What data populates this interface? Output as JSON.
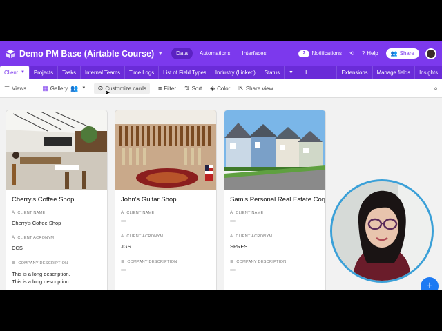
{
  "colors": {
    "brand": "#7c39ed",
    "tab_bar": "#6a2bd8",
    "fab": "#1d7af3",
    "webcam_ring": "#3aa0d8"
  },
  "header": {
    "base_title": "Demo PM Base (Airtable Course)",
    "nav": [
      "Data",
      "Automations",
      "Interfaces"
    ],
    "active_nav": "Data",
    "notifications_badge": "2",
    "notifications_label": "Notifications",
    "help_label": "Help",
    "share_label": "Share"
  },
  "tabs": {
    "items": [
      "Client",
      "Projects",
      "Tasks",
      "Internal Teams",
      "Time Logs",
      "List of Field Types",
      "Industry (Linked)",
      "Status"
    ],
    "active": "Client",
    "right": [
      "Extensions",
      "Manage fields",
      "Insights"
    ]
  },
  "toolbar": {
    "views_label": "Views",
    "view_name": "Gallery",
    "customize_label": "Customize cards",
    "filter_label": "Filter",
    "sort_label": "Sort",
    "color_label": "Color",
    "share_view_label": "Share view"
  },
  "field_labels": {
    "client_name": "CLIENT NAME",
    "client_acronym": "CLIENT ACRONYM",
    "company_description": "COMPANY DESCRIPTION"
  },
  "cards": [
    {
      "title": "Cherry's Coffee Shop",
      "client_name": "Cherry's Coffee Shop",
      "client_acronym": "CCS",
      "description": [
        "This is a long description.",
        "This is a long description."
      ]
    },
    {
      "title": "John's Guitar Shop",
      "client_name": "",
      "client_acronym": "JGS",
      "description": []
    },
    {
      "title": "Sam's Personal Real Estate Corp",
      "client_name": "",
      "client_acronym": "SPRES",
      "description": []
    }
  ],
  "icons": {
    "fab": "plus-icon",
    "search": "search-icon",
    "history": "history-icon",
    "help": "help-icon"
  }
}
